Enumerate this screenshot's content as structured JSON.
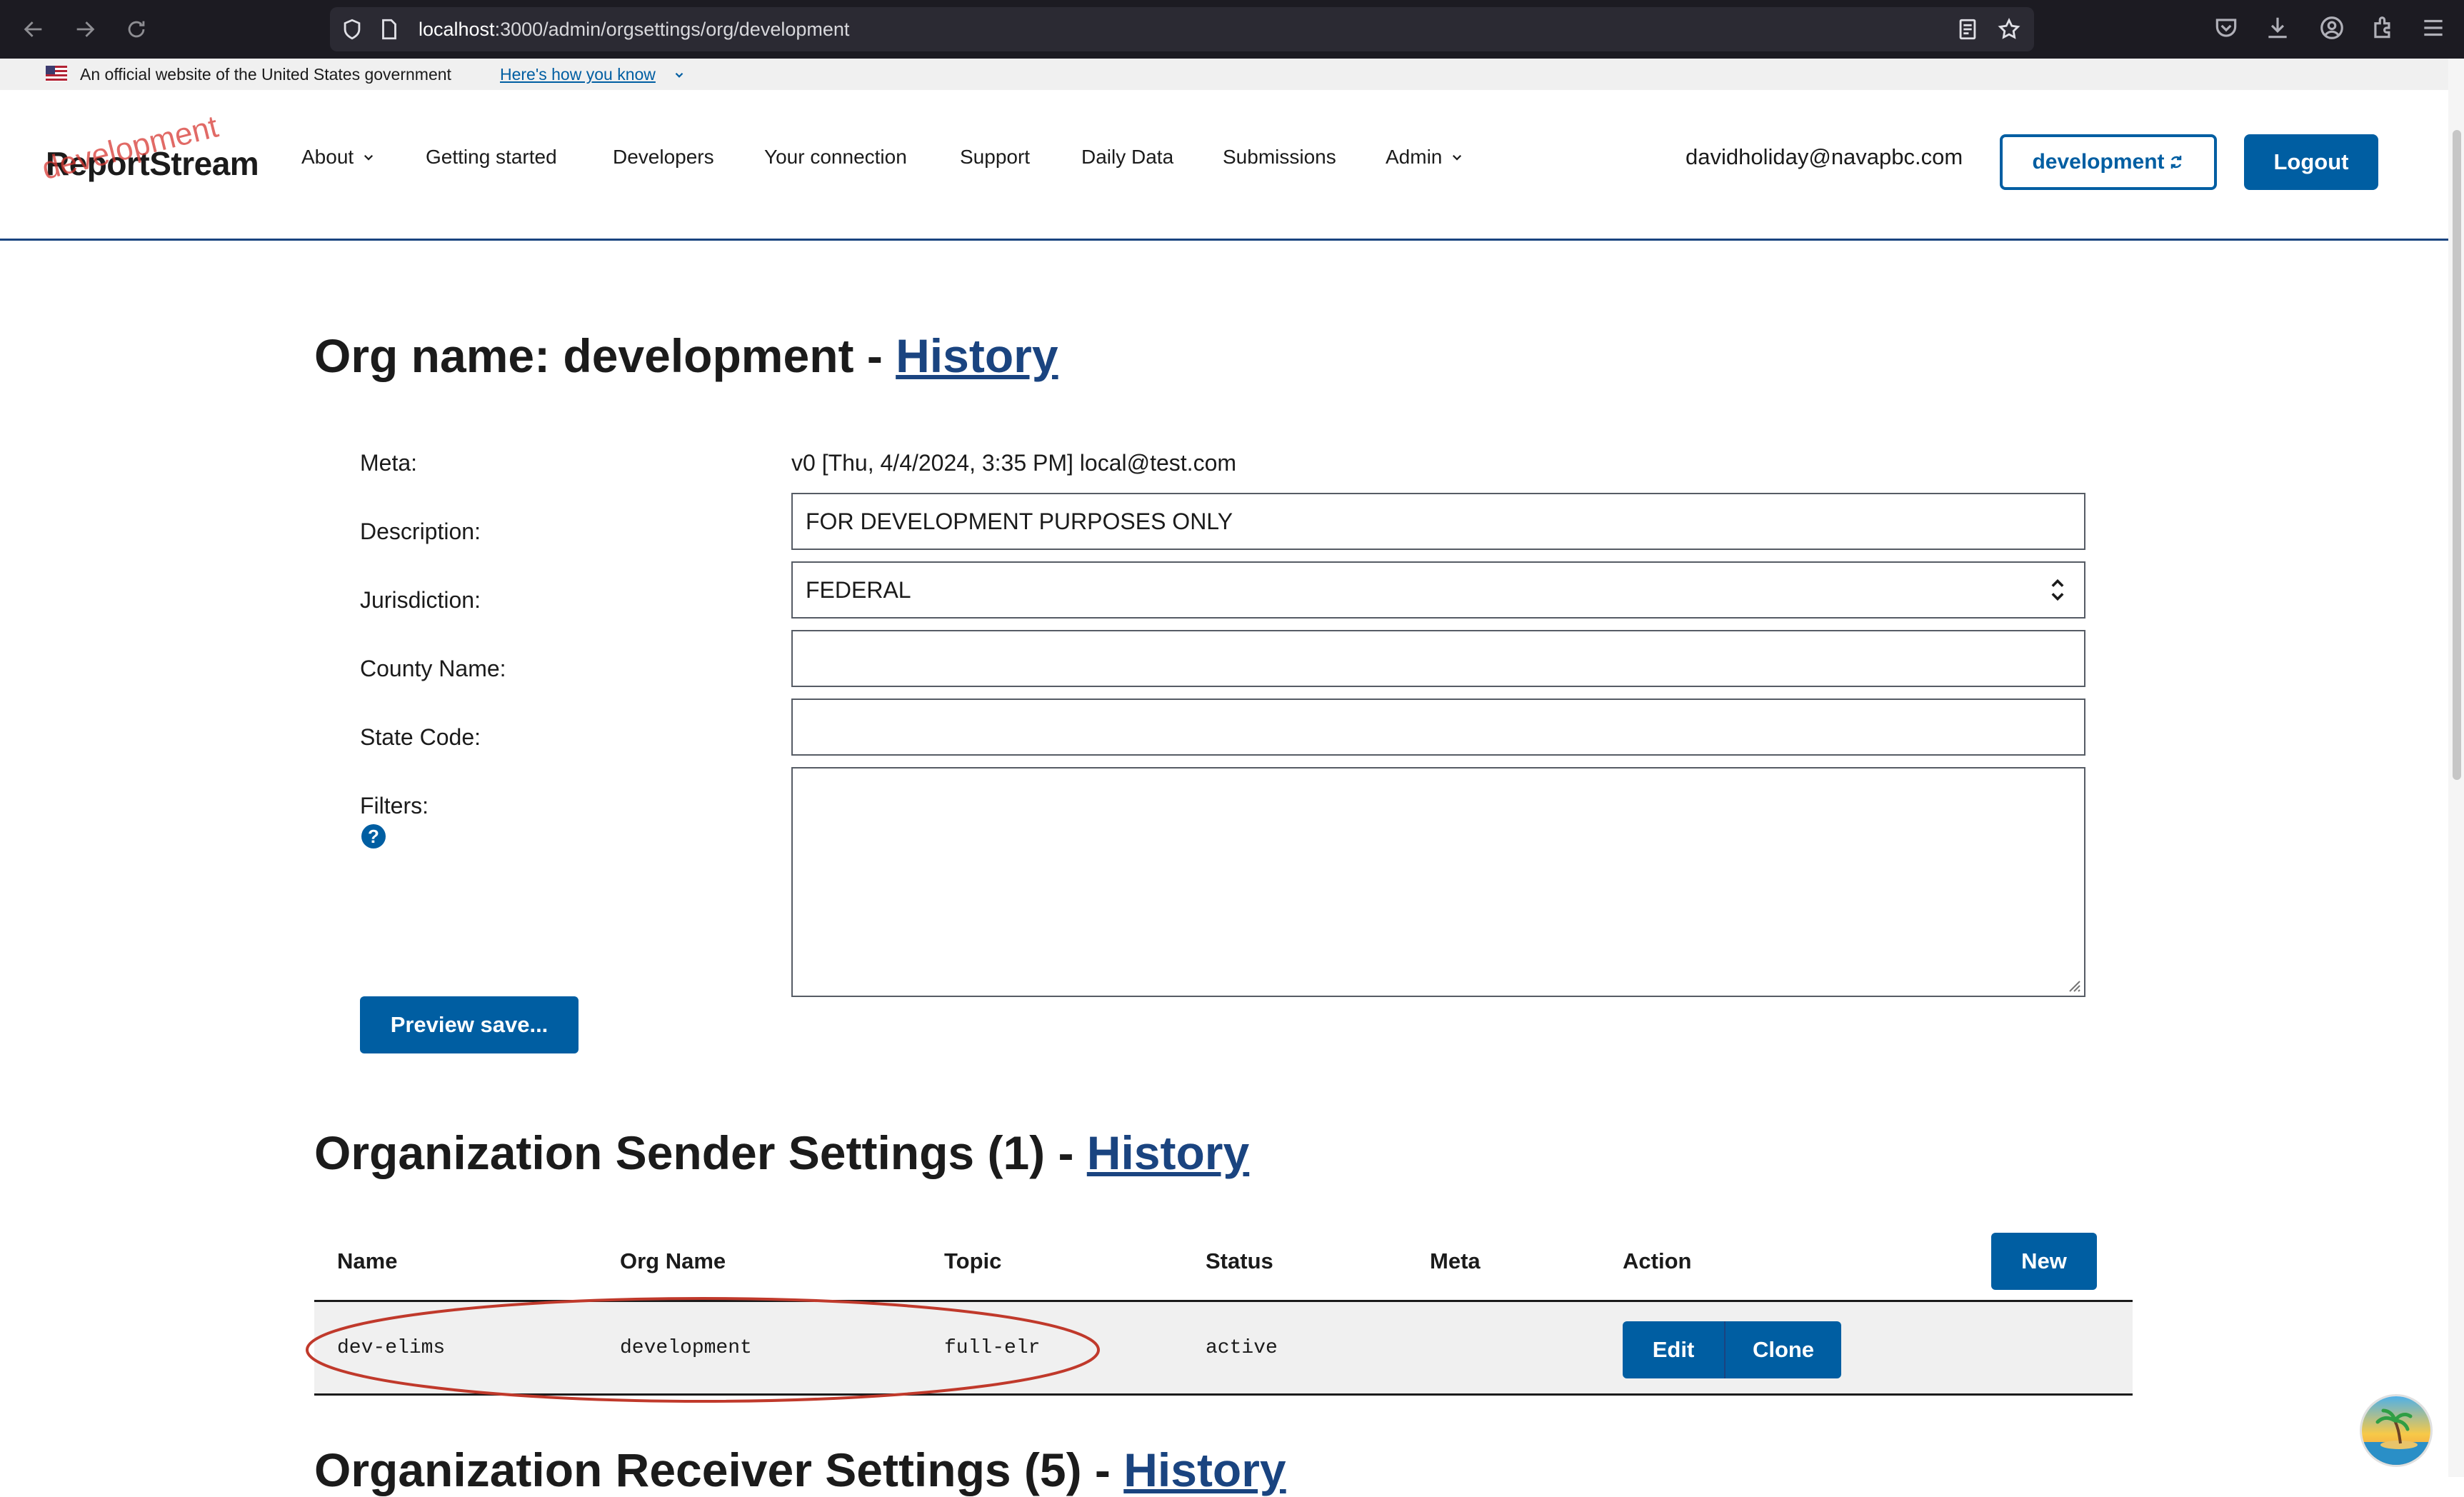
{
  "browser": {
    "url_host": "localhost",
    "url_path": ":3000/admin/orgsettings/org/development"
  },
  "gov_banner": {
    "text": "An official website of the United States government",
    "link": "Here's how you know"
  },
  "header": {
    "logo": "ReportStream",
    "env_stamp": "development",
    "nav": {
      "about": "About",
      "getting_started": "Getting started",
      "developers": "Developers",
      "your_connection": "Your connection",
      "support": "Support",
      "daily_data": "Daily Data",
      "submissions": "Submissions",
      "admin": "Admin"
    },
    "user_email": "davidholiday@navapbc.com",
    "org_button": "development",
    "logout": "Logout"
  },
  "org_form": {
    "title_prefix": "Org name: development - ",
    "title_link": "History",
    "labels": {
      "meta": "Meta:",
      "description": "Description:",
      "jurisdiction": "Jurisdiction:",
      "county_name": "County Name:",
      "state_code": "State Code:",
      "filters": "Filters:"
    },
    "meta_value": "v0 [Thu, 4/4/2024, 3:35 PM] local@test.com",
    "description_value": "FOR DEVELOPMENT PURPOSES ONLY",
    "jurisdiction_value": "FEDERAL",
    "county_name_value": "",
    "state_code_value": "",
    "filters_value": "",
    "help_icon": "?",
    "preview_button": "Preview save..."
  },
  "sender_settings": {
    "title_prefix": "Organization Sender Settings (1) - ",
    "title_link": "History",
    "columns": {
      "name": "Name",
      "org_name": "Org Name",
      "topic": "Topic",
      "status": "Status",
      "meta": "Meta",
      "action": "Action"
    },
    "new_button": "New",
    "rows": [
      {
        "name": "dev-elims",
        "org_name": "development",
        "topic": "full-elr",
        "status": "active",
        "meta": "",
        "edit": "Edit",
        "clone": "Clone"
      }
    ]
  },
  "receiver_settings": {
    "title_prefix": "Organization Receiver Settings (5) - ",
    "title_link": "History"
  },
  "colors": {
    "primary": "#005ea2",
    "heading_link": "#1a4480",
    "highlight_ellipse": "#c0392b",
    "env_stamp": "#d83933"
  }
}
